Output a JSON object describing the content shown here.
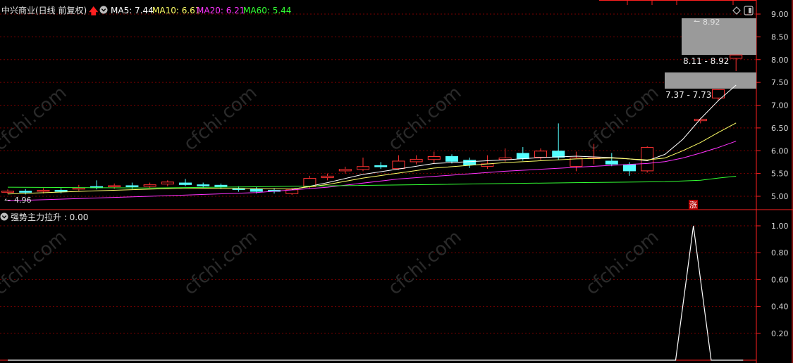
{
  "header": {
    "title": "中兴商业(日线 前复权)",
    "ma": [
      {
        "label": "MA5: 7.44",
        "color": "#ffffff"
      },
      {
        "label": "MA10: 6.61",
        "color": "#ffff66"
      },
      {
        "label": "MA20: 6.21",
        "color": "#ff33ff"
      },
      {
        "label": "MA60: 5.44",
        "color": "#33ff33"
      }
    ]
  },
  "indicator": {
    "label": "强势主力拉升 : 0.00"
  },
  "annotations": {
    "high_label": "8.92",
    "low_label": "4.96",
    "zone_upper_label": "8.11 - 8.92",
    "zone_lower_label": "7.37 - 7.73",
    "limit_badge": "涨"
  },
  "watermark": "cfchi.com",
  "colors": {
    "up": "#ff3232",
    "down": "#54ffff",
    "grid": "#7a0000",
    "axis": "#ff2020",
    "axis_text": "#d8d8d8"
  },
  "chart_data": [
    {
      "type": "candlestick",
      "title": "中兴商业(日线 前复权)",
      "ylim": [
        4.75,
        9.2
      ],
      "y_ticks": [
        5.0,
        5.5,
        6.0,
        6.5,
        7.0,
        7.5,
        8.0,
        8.5,
        9.0
      ],
      "candles": [
        {
          "o": 5.08,
          "c": 5.12,
          "h": 5.15,
          "l": 5.05
        },
        {
          "o": 5.12,
          "c": 5.08,
          "h": 5.16,
          "l": 5.04
        },
        {
          "o": 5.1,
          "c": 5.14,
          "h": 5.18,
          "l": 5.06
        },
        {
          "o": 5.14,
          "c": 5.1,
          "h": 5.18,
          "l": 5.06
        },
        {
          "o": 5.15,
          "c": 5.19,
          "h": 5.25,
          "l": 5.12
        },
        {
          "o": 5.22,
          "c": 5.18,
          "h": 5.35,
          "l": 5.15
        },
        {
          "o": 5.2,
          "c": 5.24,
          "h": 5.28,
          "l": 5.16
        },
        {
          "o": 5.24,
          "c": 5.2,
          "h": 5.3,
          "l": 5.16
        },
        {
          "o": 5.21,
          "c": 5.26,
          "h": 5.3,
          "l": 5.18
        },
        {
          "o": 5.26,
          "c": 5.32,
          "h": 5.35,
          "l": 5.22
        },
        {
          "o": 5.3,
          "c": 5.25,
          "h": 5.38,
          "l": 5.22
        },
        {
          "o": 5.26,
          "c": 5.22,
          "h": 5.3,
          "l": 5.18
        },
        {
          "o": 5.25,
          "c": 5.2,
          "h": 5.28,
          "l": 5.16
        },
        {
          "o": 5.18,
          "c": 5.14,
          "h": 5.22,
          "l": 5.1
        },
        {
          "o": 5.16,
          "c": 5.1,
          "h": 5.2,
          "l": 5.06
        },
        {
          "o": 5.14,
          "c": 5.1,
          "h": 5.18,
          "l": 5.06
        },
        {
          "o": 5.05,
          "c": 5.15,
          "h": 5.18,
          "l": 5.03
        },
        {
          "o": 5.2,
          "c": 5.4,
          "h": 5.45,
          "l": 5.18
        },
        {
          "o": 5.4,
          "c": 5.45,
          "h": 5.5,
          "l": 5.35
        },
        {
          "o": 5.55,
          "c": 5.6,
          "h": 5.65,
          "l": 5.5
        },
        {
          "o": 5.58,
          "c": 5.66,
          "h": 5.85,
          "l": 5.55
        },
        {
          "o": 5.68,
          "c": 5.64,
          "h": 5.75,
          "l": 5.6
        },
        {
          "o": 5.6,
          "c": 5.78,
          "h": 5.9,
          "l": 5.58
        },
        {
          "o": 5.75,
          "c": 5.82,
          "h": 5.9,
          "l": 5.7
        },
        {
          "o": 5.8,
          "c": 5.88,
          "h": 5.98,
          "l": 5.72
        },
        {
          "o": 5.88,
          "c": 5.76,
          "h": 5.92,
          "l": 5.72
        },
        {
          "o": 5.8,
          "c": 5.68,
          "h": 5.85,
          "l": 5.62
        },
        {
          "o": 5.65,
          "c": 5.72,
          "h": 5.9,
          "l": 5.6
        },
        {
          "o": 5.8,
          "c": 5.85,
          "h": 6.05,
          "l": 5.76
        },
        {
          "o": 5.95,
          "c": 5.82,
          "h": 6.08,
          "l": 5.78
        },
        {
          "o": 5.85,
          "c": 6.0,
          "h": 6.05,
          "l": 5.8
        },
        {
          "o": 6.0,
          "c": 5.85,
          "h": 6.6,
          "l": 5.8
        },
        {
          "o": 5.65,
          "c": 5.85,
          "h": 5.98,
          "l": 5.55
        },
        {
          "o": 5.85,
          "c": 5.85,
          "h": 6.15,
          "l": 5.7
        },
        {
          "o": 5.78,
          "c": 5.7,
          "h": 5.95,
          "l": 5.66
        },
        {
          "o": 5.7,
          "c": 5.55,
          "h": 5.75,
          "l": 5.45
        },
        {
          "o": 5.55,
          "c": 6.08,
          "h": 6.1,
          "l": 5.52
        },
        null,
        null,
        {
          "o": 6.65,
          "c": 6.7,
          "h": 6.72,
          "l": 6.6
        },
        {
          "o": 7.15,
          "c": 7.35,
          "h": 7.35,
          "l": 7.1
        },
        {
          "o": 8.02,
          "c": 8.11,
          "h": 8.11,
          "l": 7.75
        }
      ],
      "ma_series": [
        {
          "name": "MA5",
          "color": "#ffffff",
          "points": [
            [
              16,
              5.15
            ],
            [
              17,
              5.22
            ],
            [
              18,
              5.3
            ],
            [
              20,
              5.48
            ],
            [
              22,
              5.6
            ],
            [
              24,
              5.72
            ],
            [
              26,
              5.76
            ],
            [
              28,
              5.8
            ],
            [
              30,
              5.85
            ],
            [
              32,
              5.88
            ],
            [
              34,
              5.85
            ],
            [
              35,
              5.82
            ],
            [
              36,
              5.78
            ],
            [
              37,
              5.92
            ],
            [
              38,
              6.25
            ],
            [
              39,
              6.7
            ],
            [
              40,
              7.1
            ],
            [
              41,
              7.44
            ]
          ]
        },
        {
          "name": "MA10",
          "color": "#ffff66",
          "points": [
            [
              0,
              5.05
            ],
            [
              5,
              5.12
            ],
            [
              10,
              5.18
            ],
            [
              16,
              5.16
            ],
            [
              18,
              5.26
            ],
            [
              20,
              5.4
            ],
            [
              24,
              5.62
            ],
            [
              28,
              5.74
            ],
            [
              32,
              5.82
            ],
            [
              34,
              5.84
            ],
            [
              36,
              5.8
            ],
            [
              37,
              5.84
            ],
            [
              38,
              6.0
            ],
            [
              39,
              6.18
            ],
            [
              40,
              6.4
            ],
            [
              41,
              6.61
            ]
          ]
        },
        {
          "name": "MA20",
          "color": "#ff33ff",
          "points": [
            [
              0,
              4.9
            ],
            [
              8,
              5.0
            ],
            [
              14,
              5.08
            ],
            [
              18,
              5.2
            ],
            [
              22,
              5.38
            ],
            [
              28,
              5.55
            ],
            [
              34,
              5.68
            ],
            [
              36,
              5.72
            ],
            [
              37,
              5.76
            ],
            [
              38,
              5.84
            ],
            [
              39,
              5.95
            ],
            [
              40,
              6.07
            ],
            [
              41,
              6.21
            ]
          ]
        },
        {
          "name": "MA60",
          "color": "#33ff33",
          "points": [
            [
              0,
              5.2
            ],
            [
              8,
              5.18
            ],
            [
              16,
              5.22
            ],
            [
              24,
              5.26
            ],
            [
              32,
              5.3
            ],
            [
              37,
              5.32
            ],
            [
              39,
              5.35
            ],
            [
              40,
              5.4
            ],
            [
              41,
              5.44
            ]
          ]
        }
      ]
    },
    {
      "type": "line",
      "title": "强势主力拉升",
      "ylim": [
        0,
        1.05
      ],
      "y_ticks": [
        0.2,
        0.4,
        0.6,
        0.8,
        1.0
      ],
      "series": [
        {
          "values": [
            [
              0,
              0
            ],
            [
              37.6,
              0
            ],
            [
              38.6,
              1.0
            ],
            [
              39.6,
              0
            ],
            [
              41.4,
              0
            ]
          ]
        }
      ]
    }
  ]
}
